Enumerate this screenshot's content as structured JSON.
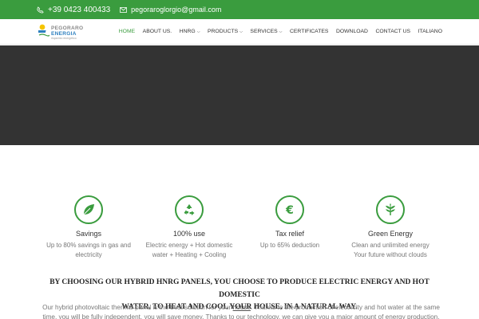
{
  "topbar": {
    "phone": "+39 0423 400433",
    "email": "pegoraroglorgio@gmail.com",
    "phone_icon": "phone-icon",
    "email_icon": "envelope-icon"
  },
  "logo": {
    "line1": "PEGORARO",
    "line2": "ENERGIA",
    "tagline": "risparmio energetico"
  },
  "nav": {
    "items": [
      {
        "label": "HOME",
        "active": true,
        "dropdown": false
      },
      {
        "label": "ABOUT US.",
        "active": false,
        "dropdown": false
      },
      {
        "label": "HNRG",
        "active": false,
        "dropdown": true
      },
      {
        "label": "PRODUCTS",
        "active": false,
        "dropdown": true
      },
      {
        "label": "SERVICES",
        "active": false,
        "dropdown": true
      },
      {
        "label": "CERTIFICATES",
        "active": false,
        "dropdown": false
      },
      {
        "label": "DOWNLOAD",
        "active": false,
        "dropdown": false
      },
      {
        "label": "CONTACT US",
        "active": false,
        "dropdown": false
      },
      {
        "label": "ITALIANO",
        "active": false,
        "dropdown": false
      }
    ]
  },
  "features": [
    {
      "icon": "leaf-icon",
      "title": "Savings",
      "desc1": "Up to 80% savings in gas and",
      "desc2": "electricity"
    },
    {
      "icon": "recycle-icon",
      "title": "100% use",
      "desc1": "Electric energy + Hot domestic",
      "desc2": "water + Heating + Cooling"
    },
    {
      "icon": "euro-icon",
      "title": "Tax relief",
      "desc1": "Up to 65% deduction",
      "desc2": ""
    },
    {
      "icon": "plant-icon",
      "title": "Green Energy",
      "desc1": "Clean and unlimited energy",
      "desc2": "Your future without clouds"
    }
  ],
  "headline": {
    "line1": "BY CHOOSING OUR HYBRID HNRG PANELS, YOU CHOOSE TO PRODUCE ELECTRIC ENERGY AND HOT DOMESTIC",
    "line2": "WATER, TO HEAT AND COOL YOUR HOUSE, IN A NATURAL WAY."
  },
  "paragraph": {
    "before": "Our hybrid photovoltaic thermal panel is the best solution for your ",
    "link": "house",
    "after": ". Thanks to the production of electricity and hot water at the same time, you will be fully independent, you will save money. Thanks to our technology, we can give you a major amount of energy production."
  },
  "colors": {
    "brand_green": "#3a9c3e",
    "hero_bg": "#333333"
  }
}
